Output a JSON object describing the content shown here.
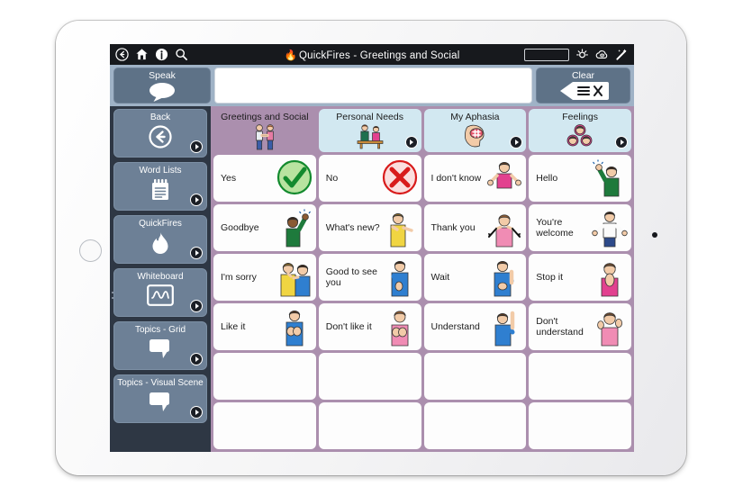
{
  "app": {
    "topbar": {
      "title": "QuickFires - Greetings and Social",
      "icons_left": [
        "back-icon",
        "home-icon",
        "info-icon",
        "search-icon"
      ],
      "icons_right": [
        "battery-indicator",
        "brightness-icon",
        "cloud-icon",
        "wand-icon"
      ]
    },
    "message_bar": {
      "speak_label": "Speak",
      "speak_icon": "speech-bubble-icon",
      "clear_label": "Clear",
      "clear_icon": "backspace-clear-icon",
      "message_text": "",
      "message_placeholder": ""
    },
    "sidebar": {
      "items": [
        {
          "label": "Back",
          "icon": "back-arrow-circle-icon",
          "badge": true
        },
        {
          "label": "Word Lists",
          "icon": "notepad-icon",
          "badge": true
        },
        {
          "label": "QuickFires",
          "icon": "flame-icon",
          "badge": true
        },
        {
          "label": "Whiteboard",
          "icon": "whiteboard-wave-icon",
          "badge": true
        },
        {
          "label": "Topics - Grid",
          "icon": "speech-bubble-icon",
          "badge": true
        },
        {
          "label": "Topics - Visual Scene",
          "icon": "speech-bubble-icon",
          "badge": true
        }
      ]
    },
    "categories": [
      {
        "label": "Greetings and Social",
        "art": "two-people-handshake",
        "active": true,
        "badge": false
      },
      {
        "label": "Personal Needs",
        "art": "two-people-table",
        "active": false,
        "badge": true
      },
      {
        "label": "My Aphasia",
        "art": "head-brain",
        "active": false,
        "badge": true
      },
      {
        "label": "Feelings",
        "art": "three-faces",
        "active": false,
        "badge": true
      }
    ],
    "grid": {
      "columns": 4,
      "rows": [
        [
          {
            "label": "Yes",
            "art": "green-check-circle"
          },
          {
            "label": "No",
            "art": "red-x-circle"
          },
          {
            "label": "I don't know",
            "art": "person-shrug-pink"
          },
          {
            "label": "Hello",
            "art": "person-wave-green"
          }
        ],
        [
          {
            "label": "Goodbye",
            "art": "person-wave-back-green"
          },
          {
            "label": "What's new?",
            "art": "person-point-yellow"
          },
          {
            "label": "Thank you",
            "art": "person-thankyou-pink"
          },
          {
            "label": "You're welcome",
            "art": "person-open-arms-white"
          }
        ],
        [
          {
            "label": "I'm sorry",
            "art": "two-people-sorry"
          },
          {
            "label": "Good to see you",
            "art": "person-thumb-blue"
          },
          {
            "label": "Wait",
            "art": "person-wait-blue"
          },
          {
            "label": "Stop it",
            "art": "person-stop-pink"
          }
        ],
        [
          {
            "label": "Like it",
            "art": "person-like-blue"
          },
          {
            "label": "Don't like it",
            "art": "person-dislike-pink"
          },
          {
            "label": "Understand",
            "art": "person-understand-blue"
          },
          {
            "label": "Don't understand",
            "art": "person-confused-pink"
          }
        ],
        [
          {
            "label": "",
            "art": ""
          },
          {
            "label": "",
            "art": ""
          },
          {
            "label": "",
            "art": ""
          },
          {
            "label": "",
            "art": ""
          }
        ],
        [
          {
            "label": "",
            "art": ""
          },
          {
            "label": "",
            "art": ""
          },
          {
            "label": "",
            "art": ""
          },
          {
            "label": "",
            "art": ""
          }
        ]
      ]
    },
    "colors": {
      "grid_background": "#ab8fae",
      "category_card": "#d2e8f1",
      "sidebar_background": "#2e3744",
      "sidebar_button": "#6d8096",
      "message_bar": "#9fb2c6",
      "topbar": "#17191d"
    }
  }
}
